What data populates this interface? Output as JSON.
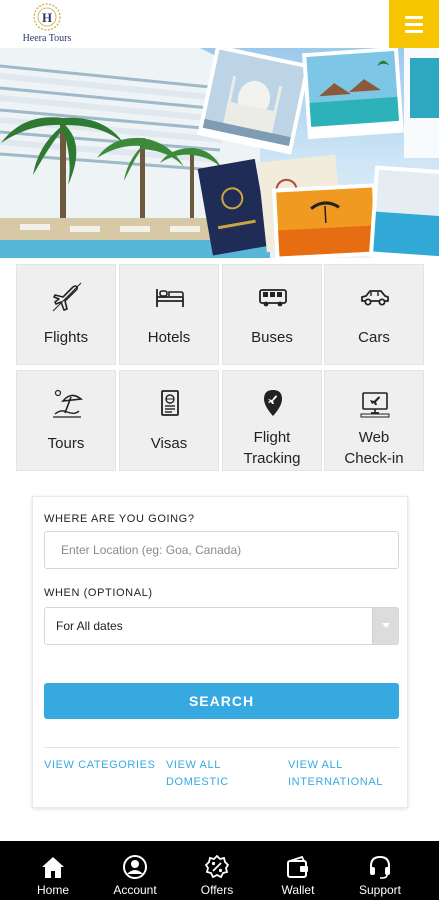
{
  "header": {
    "logo_text": "Heera Tours",
    "logo_initial": "H"
  },
  "categories": [
    {
      "label": "Flights",
      "icon": "airplane-icon"
    },
    {
      "label": "Hotels",
      "icon": "bed-icon"
    },
    {
      "label": "Buses",
      "icon": "bus-icon"
    },
    {
      "label": "Cars",
      "icon": "car-icon"
    },
    {
      "label": "Tours",
      "icon": "beach-umbrella-icon"
    },
    {
      "label": "Visas",
      "icon": "passport-icon"
    },
    {
      "label": "Flight Tracking",
      "icon": "location-pin-plane-icon"
    },
    {
      "label": "Web Check-in",
      "icon": "computer-checkin-icon"
    }
  ],
  "search": {
    "where_label": "WHERE ARE YOU GOING?",
    "location_placeholder": "Enter Location (eg: Goa, Canada)",
    "when_label": "WHEN (OPTIONAL)",
    "date_selected": "For All dates",
    "button_label": "SEARCH"
  },
  "links": {
    "categories": "VIEW CATEGORIES",
    "domestic_line1": "VIEW ALL",
    "domestic_line2": "DOMESTIC",
    "international_line1": "VIEW ALL",
    "international_line2": "INTERNATIONAL"
  },
  "bottom_nav": [
    {
      "label": "Home",
      "icon": "home-icon"
    },
    {
      "label": "Account",
      "icon": "account-icon"
    },
    {
      "label": "Offers",
      "icon": "offers-icon"
    },
    {
      "label": "Wallet",
      "icon": "wallet-icon"
    },
    {
      "label": "Support",
      "icon": "support-headset-icon"
    }
  ],
  "colors": {
    "accent_yellow": "#f6c400",
    "accent_blue": "#37a9e1",
    "tile_bg": "#efefef",
    "nav_bg": "#000000"
  }
}
